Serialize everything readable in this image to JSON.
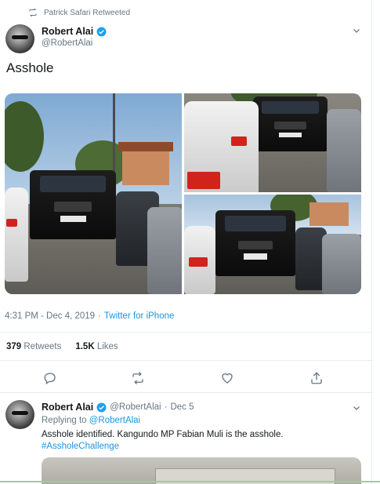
{
  "retweet_context": {
    "icon": "retweet-icon",
    "text": "Patrick Safari Retweeted"
  },
  "tweet": {
    "author": {
      "name": "Robert Alai",
      "handle": "@RobertAlai",
      "verified": true
    },
    "text": "Asshole",
    "timestamp": "4:31 PM - Dec 4, 2019",
    "separator": "·",
    "source": "Twitter for iPhone",
    "stats": {
      "retweets_value": "379",
      "retweets_label": "Retweets",
      "likes_value": "1.5K",
      "likes_label": "Likes"
    },
    "actions": [
      "reply-icon",
      "retweet-icon",
      "like-icon",
      "share-icon"
    ]
  },
  "reply": {
    "author": {
      "name": "Robert Alai",
      "handle": "@RobertAlai",
      "verified": true
    },
    "separator": "·",
    "date": "Dec 5",
    "replying_prefix": "Replying to",
    "replying_to": "@RobertAlai",
    "text": "Asshole identified. Kangundo MP Fabian Muli is the asshole.",
    "hashtag": "#AssholeChallenge"
  },
  "colors": {
    "link": "#1b95e0",
    "secondary_text": "#657786",
    "verified": "#1da1f2"
  }
}
